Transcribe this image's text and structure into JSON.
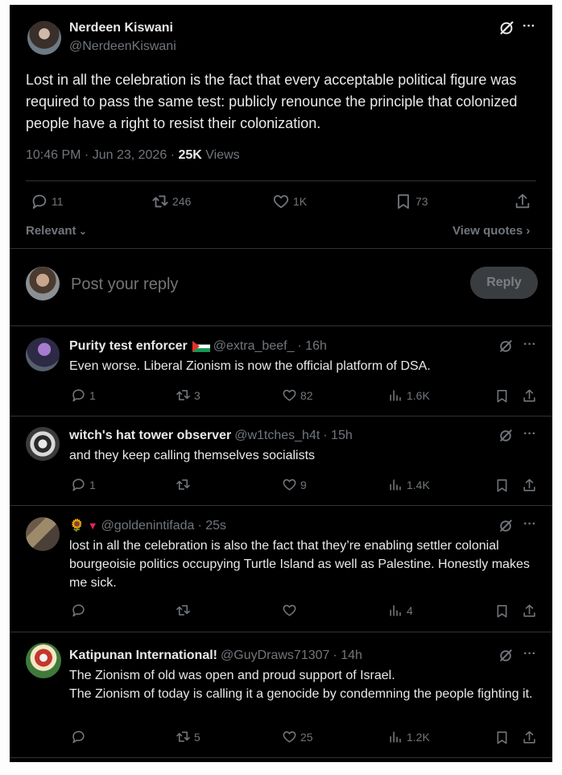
{
  "main_post": {
    "name": "Nerdeen Kiswani",
    "handle": "@NerdeenKiswani",
    "text": "Lost in all the celebration is the fact that every acceptable political figure was required to pass the same test: publicly renounce the principle that colonized people have a right to resist their colonization.",
    "timestamp": "10:46 PM · Jun 23, 2026 · ",
    "views_count": "25K",
    "views_label": " Views",
    "more": "···",
    "stats": {
      "replies": "11",
      "reposts": "246",
      "likes": "1K",
      "bookmarks": "73"
    }
  },
  "sort": {
    "label": "Relevant",
    "view_quotes": "View quotes"
  },
  "reply_box": {
    "placeholder": "Post your reply",
    "button": "Reply"
  },
  "replies": [
    {
      "name": "Purity test enforcer",
      "flag": "palestine",
      "handle": "@extra_beef_",
      "time": " · 16h",
      "text": "Even worse. Liberal Zionism is now the official platform of DSA.",
      "replies": "1",
      "reposts": "3",
      "likes": "82",
      "views": "1.6K"
    },
    {
      "name": "witch's hat tower observer",
      "handle": "@w1tches_h4t",
      "time": " · 15h",
      "text": "and they keep calling themselves socialists",
      "replies": "1",
      "reposts": "",
      "likes": "9",
      "views": "1.4K"
    },
    {
      "name": "🌻",
      "handle": "@goldenintifada",
      "time": " · 25s",
      "text": "lost in all the celebration is also the fact that they’re enabling settler colonial bourgeoisie politics occupying Turtle Island as well as Palestine. Honestly makes me sick.",
      "replies": "",
      "reposts": "",
      "likes": "",
      "views": "4"
    },
    {
      "name": "Katipunan International!",
      "handle": "@GuyDraws71307",
      "time": " · 14h",
      "text_line1": "The Zionism of old was open and proud support of Israel.",
      "text_line2": "The Zionism of today is calling it a genocide by condemning the people fighting it.",
      "replies": "",
      "reposts": "5",
      "likes": "25",
      "views": "1.2K"
    }
  ],
  "colors": {
    "background": "#000000",
    "text": "#e7e9ea",
    "muted": "#71767b",
    "divider": "#2f3336",
    "reply_button": "#3a3d40"
  }
}
